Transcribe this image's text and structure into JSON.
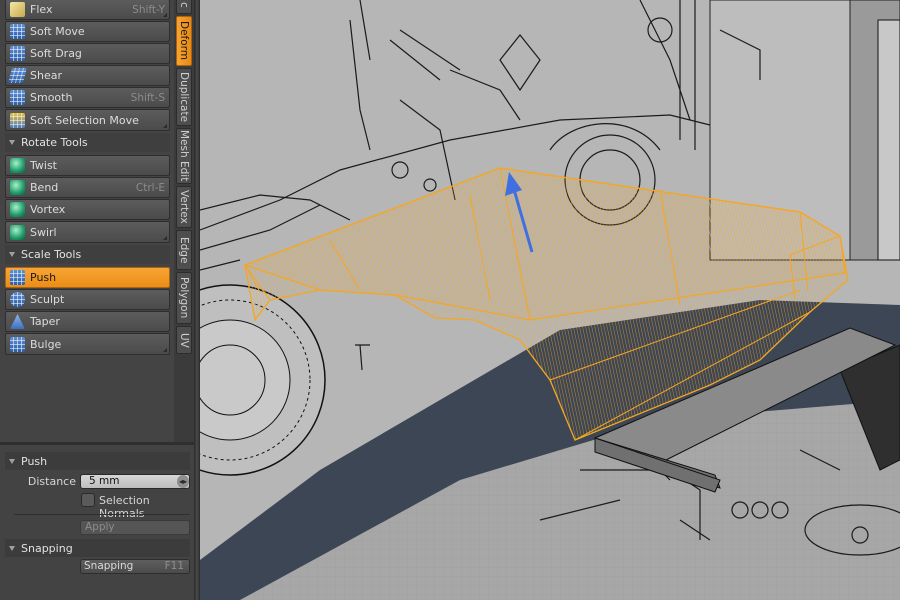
{
  "tool_groups": {
    "deform_tools": [
      {
        "label": "Flex",
        "shortcut": "Shift-Y",
        "icon": "flex-icon"
      },
      {
        "label": "Soft Move",
        "shortcut": "",
        "icon": "soft-move-icon"
      },
      {
        "label": "Soft Drag",
        "shortcut": "",
        "icon": "soft-drag-icon"
      },
      {
        "label": "Shear",
        "shortcut": "",
        "icon": "shear-icon"
      },
      {
        "label": "Smooth",
        "shortcut": "Shift-S",
        "icon": "smooth-icon"
      },
      {
        "label": "Soft Selection Move",
        "shortcut": "",
        "icon": "soft-selection-move-icon"
      }
    ],
    "rotate_header": "Rotate Tools",
    "rotate_tools": [
      {
        "label": "Twist",
        "shortcut": "",
        "icon": "twist-icon"
      },
      {
        "label": "Bend",
        "shortcut": "Ctrl-E",
        "icon": "bend-icon"
      },
      {
        "label": "Vortex",
        "shortcut": "",
        "icon": "vortex-icon"
      },
      {
        "label": "Swirl",
        "shortcut": "",
        "icon": "swirl-icon"
      }
    ],
    "scale_header": "Scale Tools",
    "scale_tools": [
      {
        "label": "Push",
        "shortcut": "",
        "icon": "push-icon",
        "active": true
      },
      {
        "label": "Sculpt",
        "shortcut": "",
        "icon": "sculpt-icon"
      },
      {
        "label": "Taper",
        "shortcut": "",
        "icon": "taper-icon"
      },
      {
        "label": "Bulge",
        "shortcut": "",
        "icon": "bulge-icon"
      }
    ]
  },
  "vertical_tabs": [
    {
      "label": "c",
      "active": false
    },
    {
      "label": "Deform",
      "active": true
    },
    {
      "label": "Duplicate",
      "active": false
    },
    {
      "label": "Mesh Edit",
      "active": false
    },
    {
      "label": "Vertex",
      "active": false
    },
    {
      "label": "Edge",
      "active": false
    },
    {
      "label": "Polygon",
      "active": false
    },
    {
      "label": "UV",
      "active": false
    }
  ],
  "properties": {
    "push_header": "Push",
    "distance_label": "Distance",
    "distance_value": "5 mm",
    "selection_normals_label": "Selection Normals",
    "selection_normals_checked": false,
    "apply_label": "Apply",
    "snapping_header": "Snapping",
    "snapping_button_label": "Snapping",
    "snapping_shortcut": "F11"
  },
  "colors": {
    "accent": "#f39a22",
    "selection_wire": "#f5a623",
    "push_handle": "#3f6fe0"
  }
}
